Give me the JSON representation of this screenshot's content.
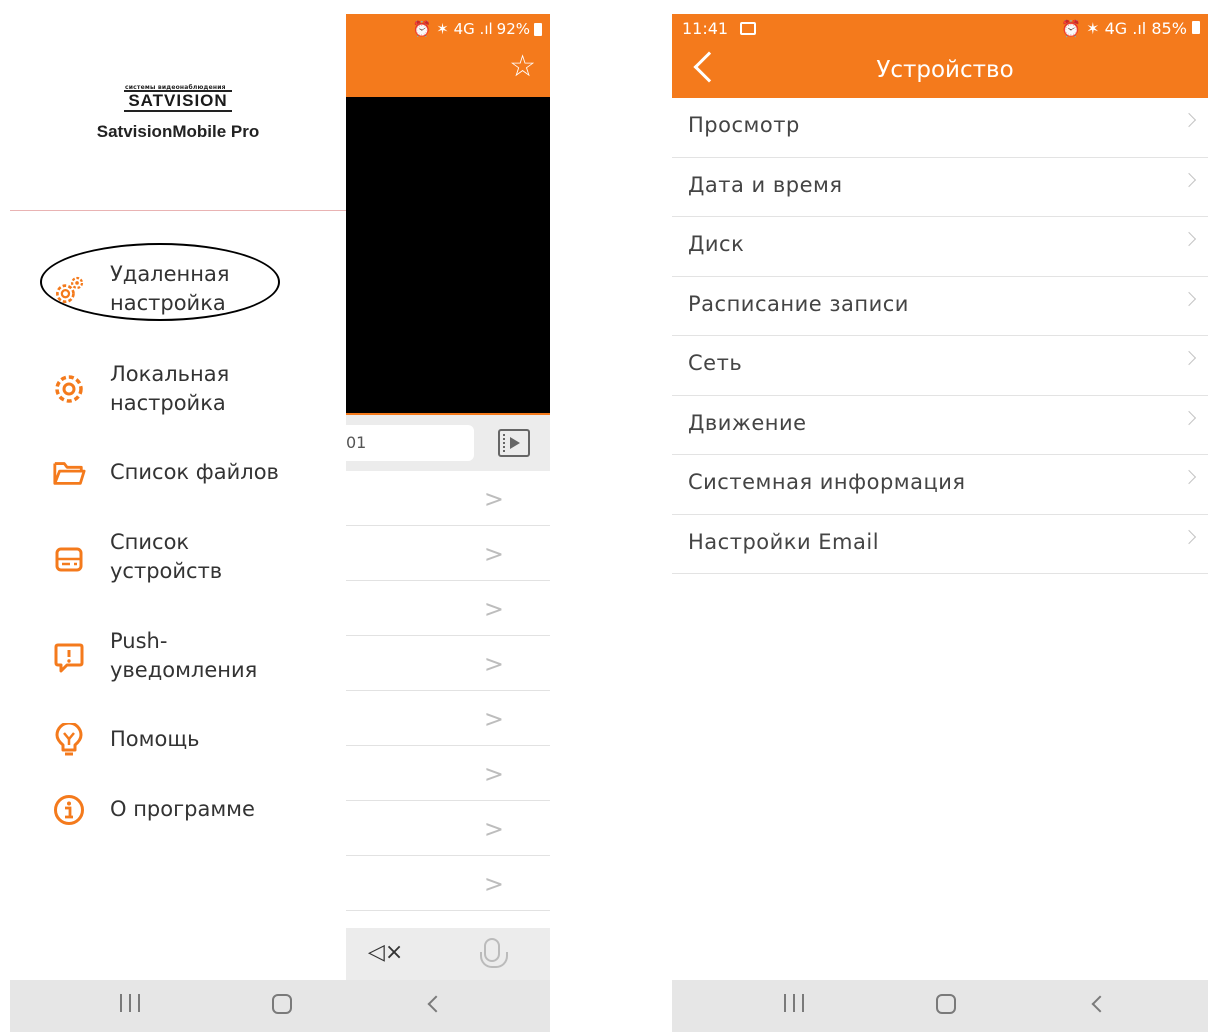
{
  "left_phone": {
    "status": {
      "icons": "⏰ ✶ 4G .ıl",
      "battery": "92%"
    },
    "logo": {
      "tagline": "системы видеонаблюдения",
      "brand": "SATVISION"
    },
    "app_name": "SatvisionMobile Pro",
    "menu": [
      {
        "label": "Удаленная настройка",
        "icon": "remote-settings-gears-icon",
        "highlighted": true
      },
      {
        "label": "Локальная настройка",
        "icon": "local-settings-gear-icon"
      },
      {
        "label": "Список файлов",
        "icon": "folder-icon"
      },
      {
        "label": "Список устройств",
        "icon": "device-list-icon"
      },
      {
        "label": "Push-уведомления",
        "icon": "push-notification-icon"
      },
      {
        "label": "Помощь",
        "icon": "lightbulb-help-icon"
      },
      {
        "label": "О программе",
        "icon": "info-icon"
      }
    ],
    "behind": {
      "input_value": "01"
    }
  },
  "right_phone": {
    "status": {
      "time": "11:41",
      "icons": "⏰ ✶ 4G .ıl",
      "battery": "85%"
    },
    "title": "Устройство",
    "items": [
      "Просмотр",
      "Дата и время",
      "Диск",
      "Расписание записи",
      "Сеть",
      "Движение",
      "Системная информация",
      "Настройки Email"
    ]
  },
  "colors": {
    "accent": "#f47a1c",
    "text": "#333333",
    "divider": "#e3e3e3"
  }
}
